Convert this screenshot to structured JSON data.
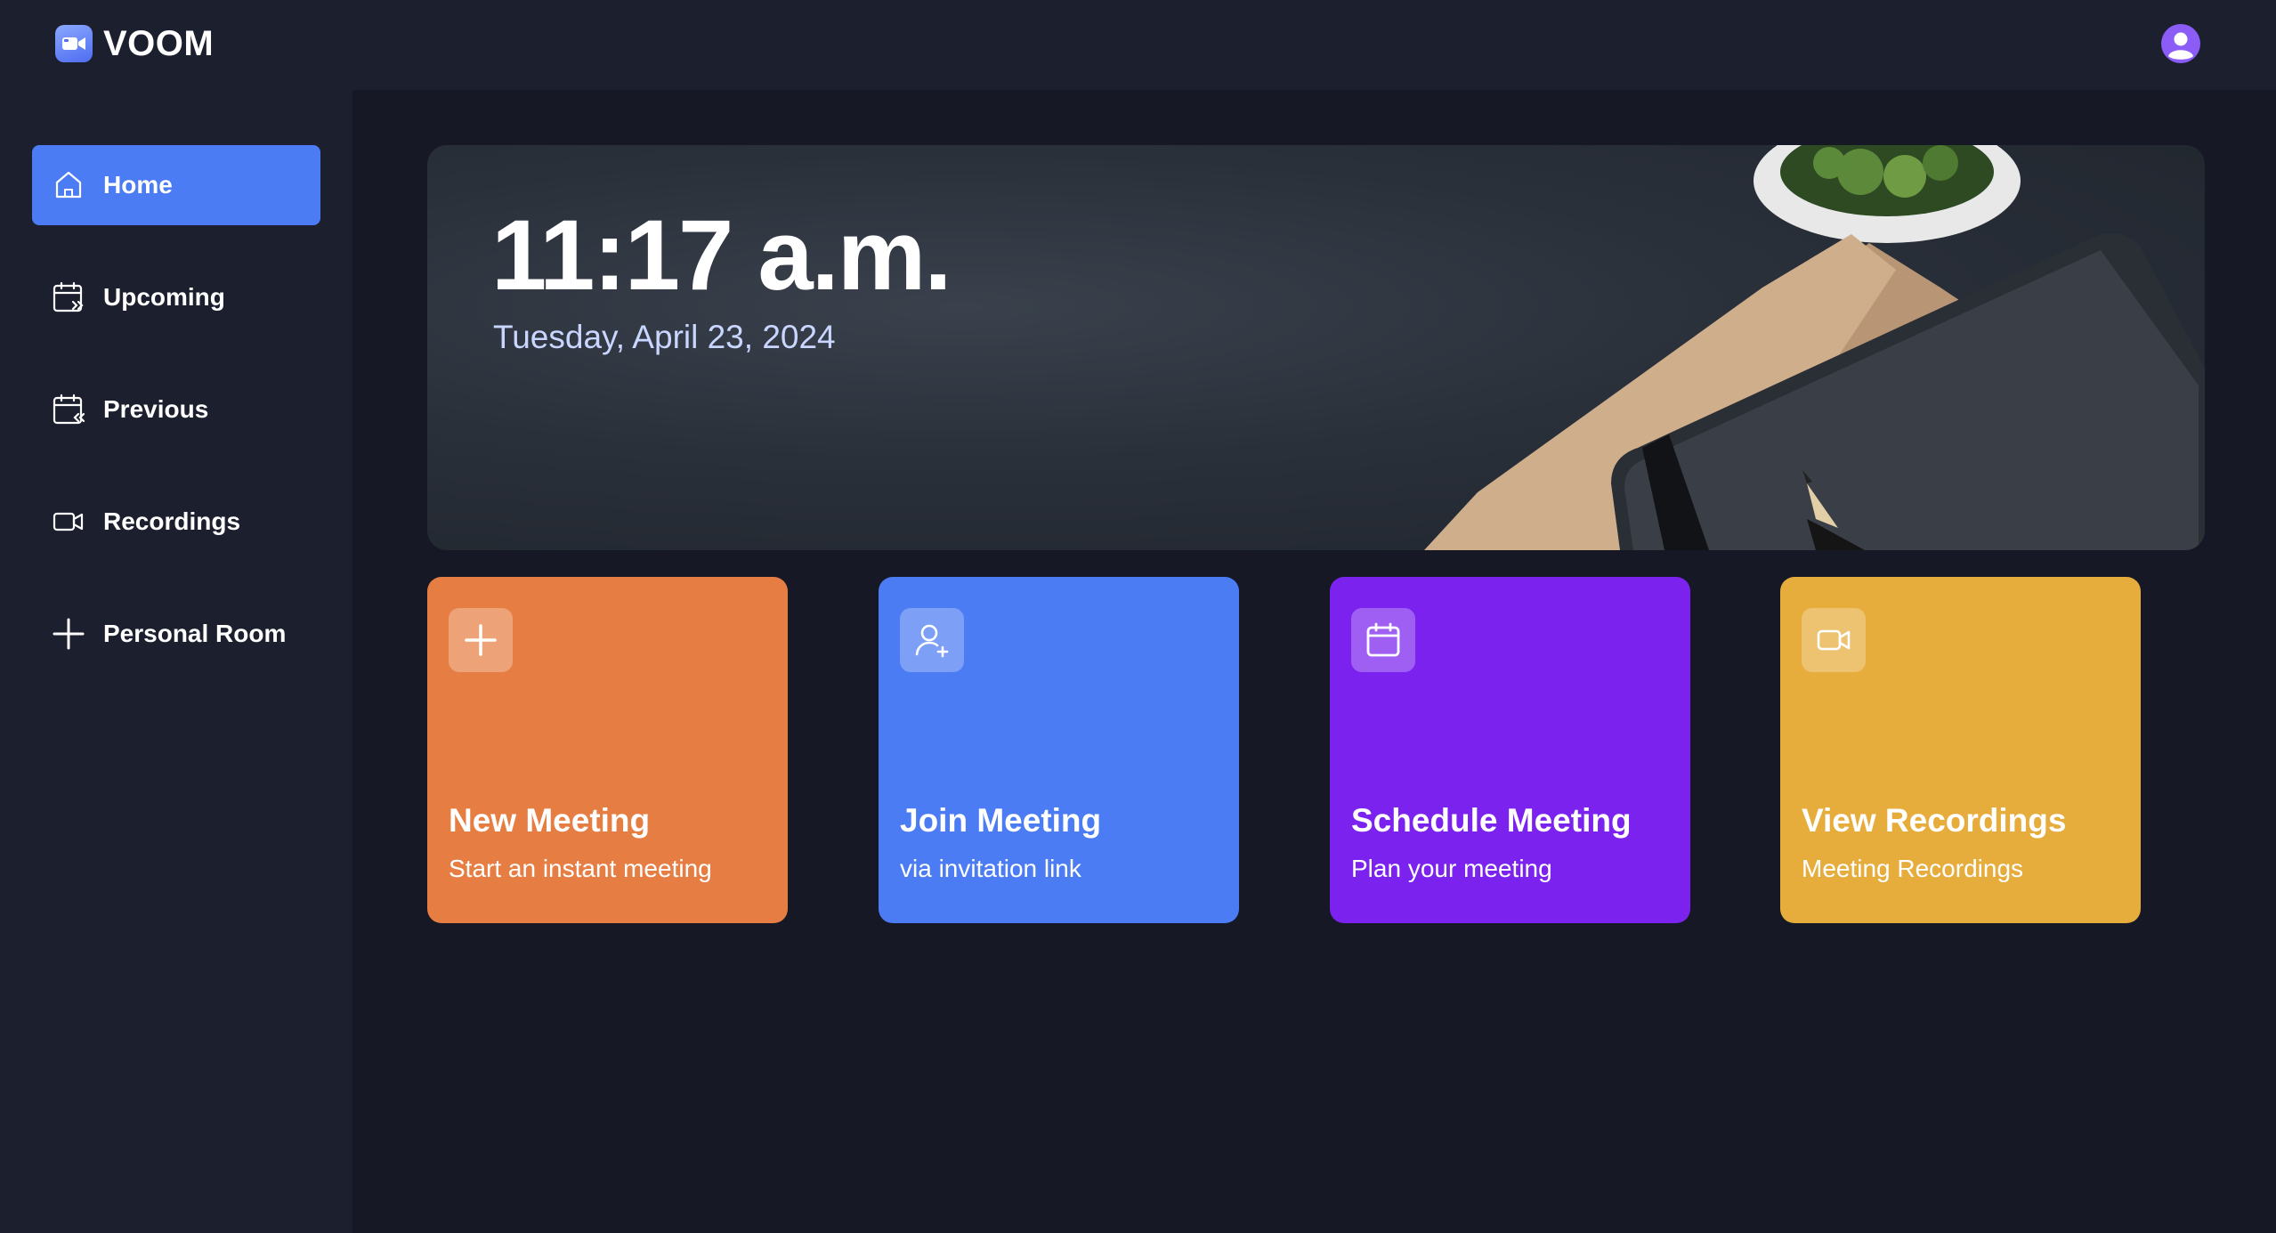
{
  "app": {
    "name": "VOOM"
  },
  "sidebar": {
    "items": [
      {
        "label": "Home",
        "icon": "home-icon",
        "active": true
      },
      {
        "label": "Upcoming",
        "icon": "calendar-upcoming-icon",
        "active": false
      },
      {
        "label": "Previous",
        "icon": "calendar-previous-icon",
        "active": false
      },
      {
        "label": "Recordings",
        "icon": "video-icon",
        "active": false
      },
      {
        "label": "Personal Room",
        "icon": "plus-icon",
        "active": false
      }
    ]
  },
  "hero": {
    "time": "11:17 a.m.",
    "date": "Tuesday, April 23, 2024"
  },
  "cards": [
    {
      "title": "New Meeting",
      "subtitle": "Start an instant meeting",
      "icon": "plus-icon",
      "color": "#e67e43"
    },
    {
      "title": "Join Meeting",
      "subtitle": "via invitation link",
      "icon": "add-user-icon",
      "color": "#4b7cf3"
    },
    {
      "title": "Schedule Meeting",
      "subtitle": "Plan your meeting",
      "icon": "calendar-icon",
      "color": "#7b22ee"
    },
    {
      "title": "View Recordings",
      "subtitle": "Meeting Recordings",
      "icon": "video-icon",
      "color": "#e6ac3c"
    }
  ],
  "colors": {
    "background": "#1c1f2e",
    "main_background": "#161925",
    "accent": "#4b7cf3",
    "avatar": "#8b5cf6"
  }
}
